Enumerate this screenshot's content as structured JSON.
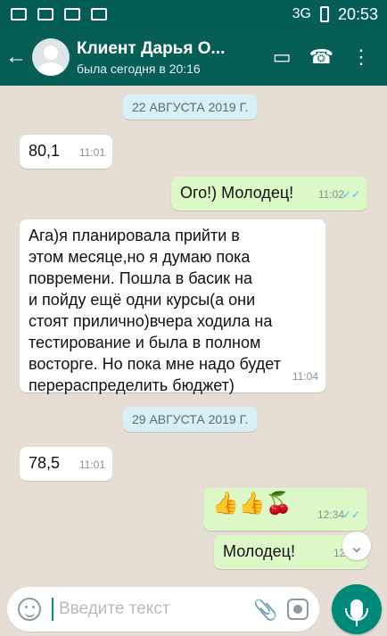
{
  "status_bar": {
    "network": "3G",
    "network_sup": "3G",
    "time": "20:53"
  },
  "header": {
    "contact_name": "Клиент Дарья О...",
    "last_seen": "была сегодня в 20:16"
  },
  "chat": {
    "date_1": "22 АВГУСТА 2019 Г.",
    "date_2": "29 АВГУСТА 2019 Г.",
    "messages": [
      {
        "text": "80,1",
        "time": "11:01",
        "direction": "in"
      },
      {
        "text": "Ого!) Молодец!",
        "time": "11:02",
        "direction": "out"
      },
      {
        "text": "Ага)я планировала прийти в\nэтом месяце,но я думаю пока\nповремени. Пошла в басик на\nи пойду ещё одни курсы(а они\nстоят прилично)вчера ходила на\nтестирование и была в полном\nвосторге. Но пока мне надо будет\nперераспределить бюджет)",
        "time": "11:04",
        "direction": "in"
      },
      {
        "text": "78,5",
        "time": "11:01",
        "direction": "in"
      },
      {
        "text": "👍👍🍒",
        "time": "12:34",
        "direction": "out"
      },
      {
        "text": "Молодец!",
        "time": "12:34",
        "direction": "out"
      }
    ]
  },
  "composer": {
    "placeholder": "Введите текст"
  },
  "icons": {
    "back": "back-arrow-icon",
    "video": "video-call-icon",
    "call": "phone-icon",
    "menu": "more-vertical-icon",
    "emoji": "emoji-icon",
    "attach": "paperclip-icon",
    "camera": "camera-icon",
    "mic": "mic-icon",
    "scroll": "chevron-double-down-icon"
  },
  "colors": {
    "header": "#075e54",
    "status_bar": "#045e54",
    "outgoing_bubble": "#dcf8c6",
    "incoming_bubble": "#ffffff",
    "background": "#e6ddd4",
    "mic_button": "#00897b"
  }
}
